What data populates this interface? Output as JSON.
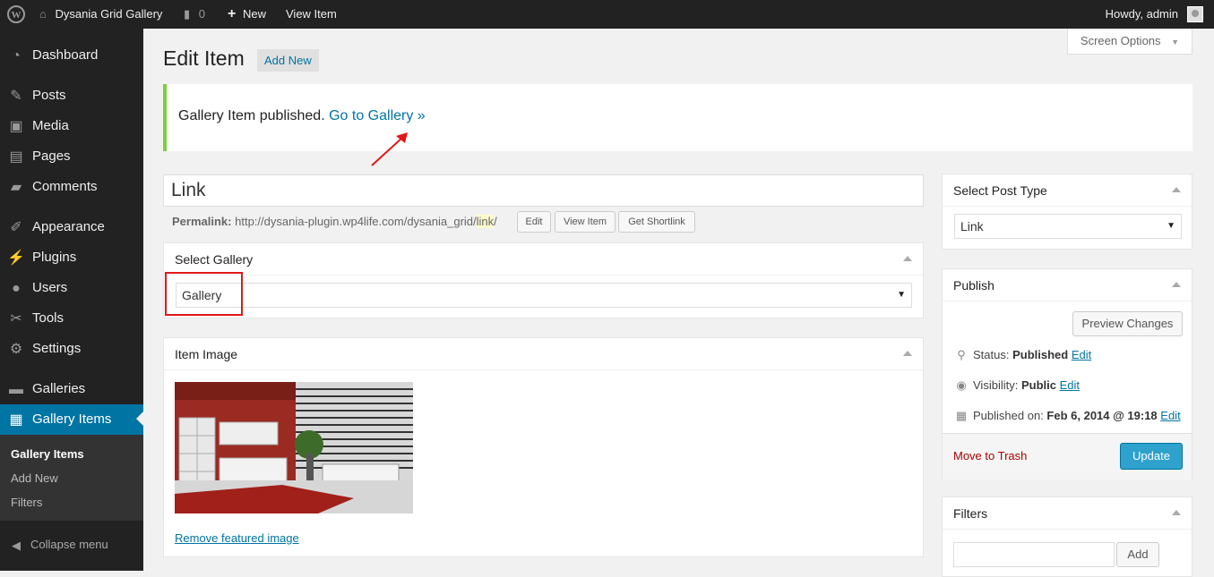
{
  "adminbar": {
    "site_name": "Dysania Grid Gallery",
    "comments_count": "0",
    "new_label": "New",
    "view_item_label": "View Item",
    "greeting": "Howdy, admin"
  },
  "sidebar": {
    "items": [
      {
        "label": "Dashboard",
        "icon": "dashboard-icon"
      },
      {
        "label": "Posts",
        "icon": "pin-icon"
      },
      {
        "label": "Media",
        "icon": "media-icon"
      },
      {
        "label": "Pages",
        "icon": "pages-icon"
      },
      {
        "label": "Comments",
        "icon": "comment-icon"
      },
      {
        "label": "Appearance",
        "icon": "brush-icon"
      },
      {
        "label": "Plugins",
        "icon": "plug-icon"
      },
      {
        "label": "Users",
        "icon": "user-icon"
      },
      {
        "label": "Tools",
        "icon": "wrench-icon"
      },
      {
        "label": "Settings",
        "icon": "settings-icon"
      },
      {
        "label": "Galleries",
        "icon": "folder-icon"
      },
      {
        "label": "Gallery Items",
        "icon": "gallery-icon"
      }
    ],
    "submenu": [
      "Gallery Items",
      "Add New",
      "Filters"
    ],
    "collapse_label": "Collapse menu"
  },
  "header": {
    "title": "Edit Item",
    "add_new": "Add New",
    "screen_options": "Screen Options"
  },
  "notice": {
    "text": "Gallery Item published.",
    "link": "Go to Gallery »"
  },
  "post": {
    "title": "Link",
    "permalink_label": "Permalink:",
    "permalink_base": "http://dysania-plugin.wp4life.com/dysania_grid/",
    "permalink_slug": "link",
    "permalink_end": "/",
    "edit_btn": "Edit",
    "view_item_btn": "View Item",
    "shortlink_btn": "Get Shortlink"
  },
  "select_gallery": {
    "title": "Select Gallery",
    "value": "Gallery"
  },
  "item_image": {
    "title": "Item Image",
    "remove_link": "Remove featured image"
  },
  "post_type": {
    "title": "Select Post Type",
    "value": "Link"
  },
  "publish": {
    "title": "Publish",
    "preview_btn": "Preview Changes",
    "status_label": "Status:",
    "status_value": "Published",
    "visibility_label": "Visibility:",
    "visibility_value": "Public",
    "published_label": "Published on:",
    "published_value": "Feb 6, 2014 @ 19:18",
    "edit_link": "Edit",
    "trash_link": "Move to Trash",
    "update_btn": "Update"
  },
  "filters": {
    "title": "Filters",
    "add_btn": "Add"
  },
  "colors": {
    "admin_bar": "#222222",
    "accent": "#0074a2",
    "notice_border": "#7ad03a",
    "annotation_red": "#e01818"
  }
}
